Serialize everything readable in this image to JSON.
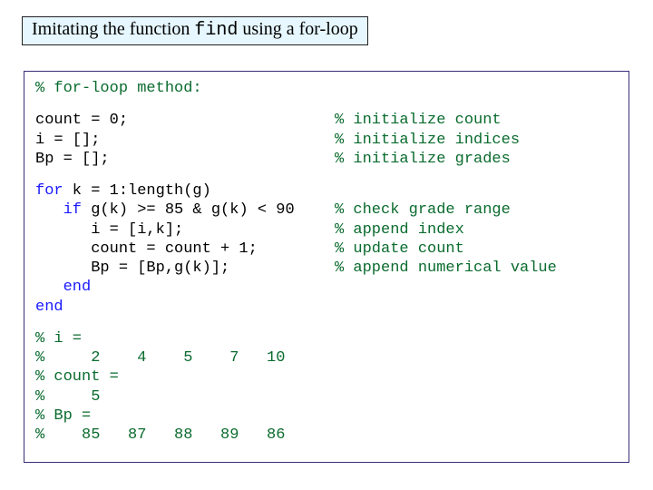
{
  "title": {
    "prefix": "Imitating the function ",
    "code": "find",
    "suffix": " using a for-loop"
  },
  "lines": {
    "header": "% for-loop method:",
    "init1_l": "count = 0;",
    "init1_r": "% initialize count",
    "init2_l": "i = [];",
    "init2_r": "% initialize indices",
    "init3_l": "Bp = [];",
    "init3_r": "% initialize grades",
    "for_kw": "for",
    "for_rest": " k = 1:length(g)",
    "if_kw": "if",
    "if_pad": "   ",
    "if_cond": " g(k) >= 85 & g(k) < 90",
    "if_r": "% check grade range",
    "b1_l": "      i = [i,k];",
    "b1_r": "% append index",
    "b2_l": "      count = count + 1;",
    "b2_r": "% update count",
    "b3_l": "      Bp = [Bp,g(k)];",
    "b3_r": "% append numerical value",
    "end1_pad": "   ",
    "end1": "end",
    "end2": "end",
    "out1": "% i =",
    "out2": "%     2    4    5    7   10",
    "out3": "% count =",
    "out4": "%     5",
    "out5": "% Bp =",
    "out6": "%    85   87   88   89   86"
  },
  "chart_data": {
    "type": "table",
    "title": "Output of for-loop method imitating find",
    "series": [
      {
        "name": "i",
        "values": [
          2,
          4,
          5,
          7,
          10
        ]
      },
      {
        "name": "count",
        "values": [
          5
        ]
      },
      {
        "name": "Bp",
        "values": [
          85,
          87,
          88,
          89,
          86
        ]
      }
    ]
  }
}
